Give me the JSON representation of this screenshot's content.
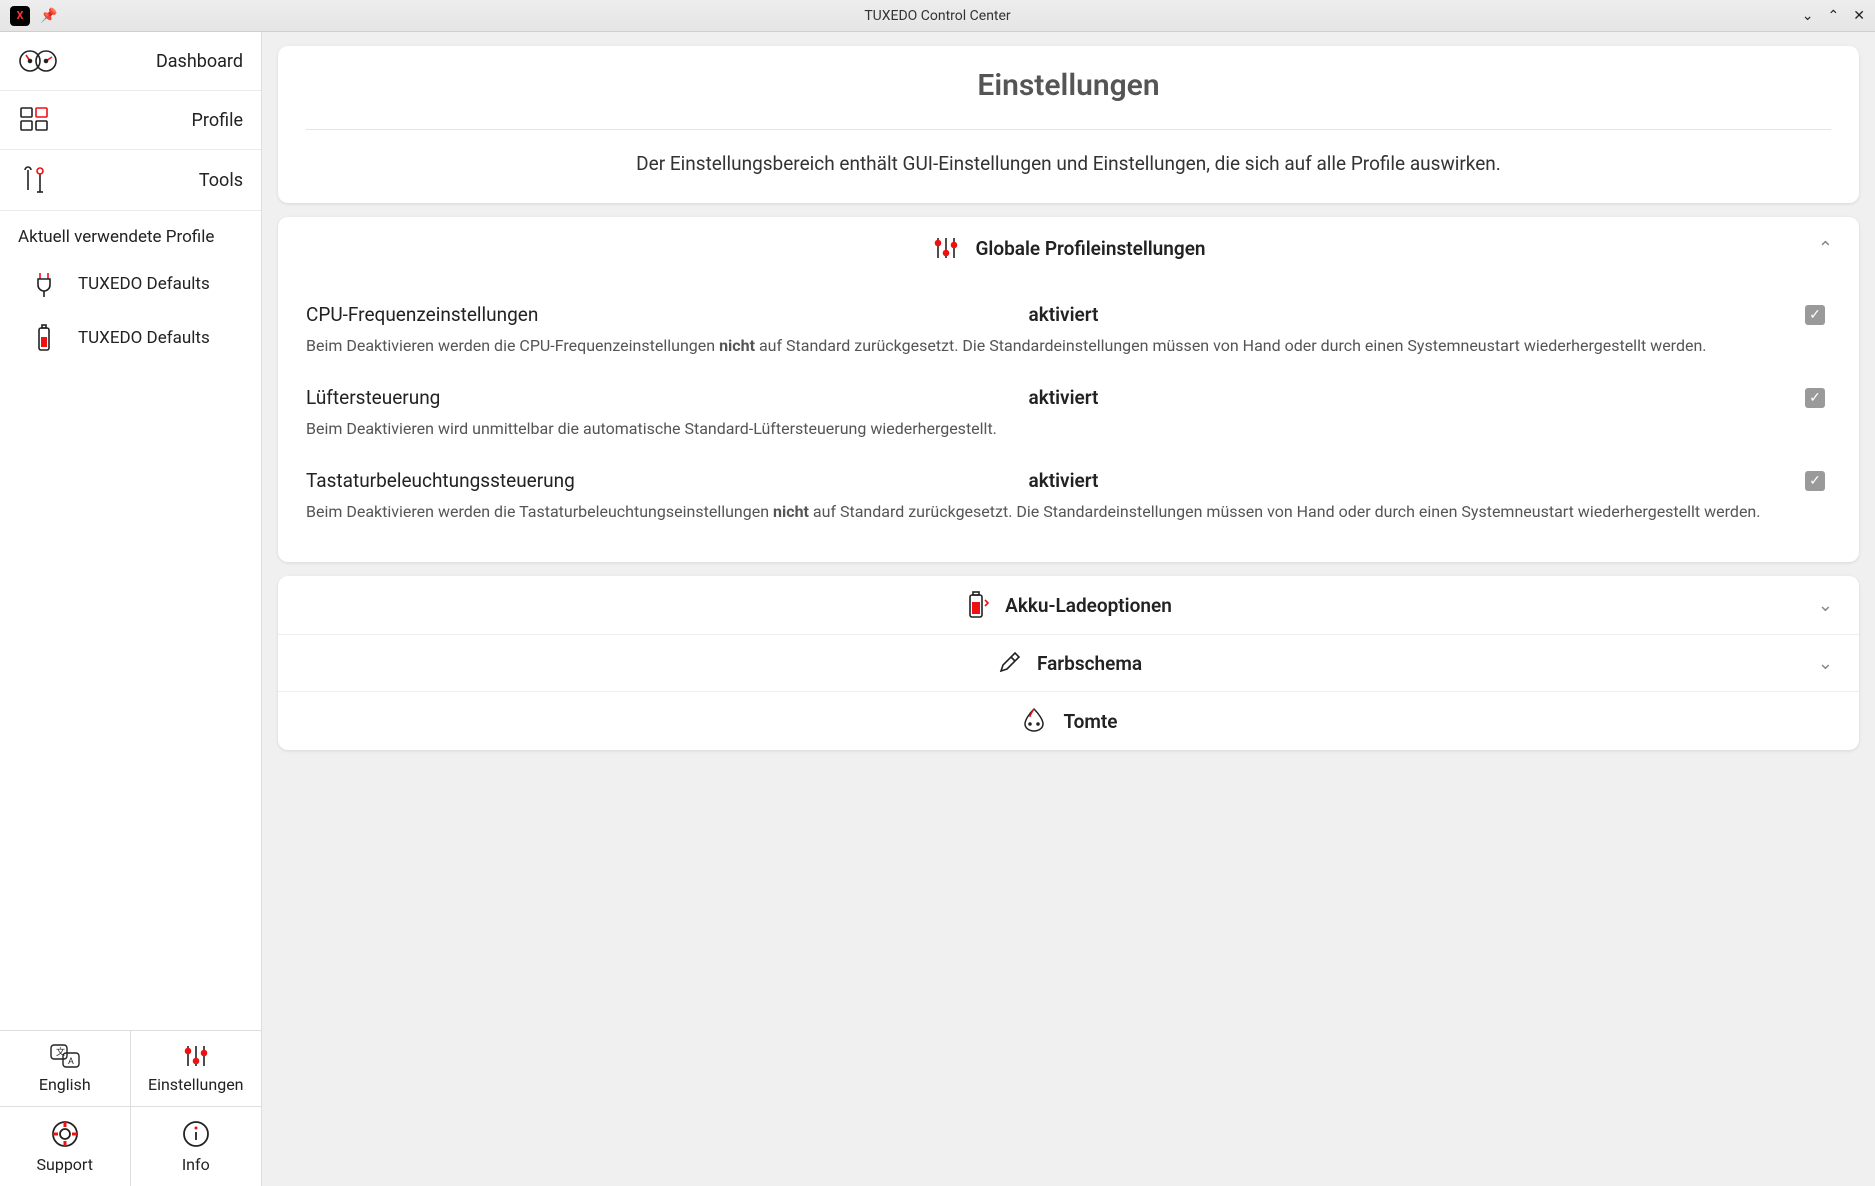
{
  "titlebar": {
    "title": "TUXEDO Control Center"
  },
  "sidebar": {
    "nav": [
      {
        "label": "Dashboard"
      },
      {
        "label": "Profile"
      },
      {
        "label": "Tools"
      }
    ],
    "section_label": "Aktuell verwendete Profile",
    "profiles": [
      {
        "label": "TUXEDO Defaults"
      },
      {
        "label": "TUXEDO Defaults"
      }
    ],
    "bottom": {
      "language": "English",
      "settings": "Einstellungen",
      "support": "Support",
      "info": "Info"
    }
  },
  "header_card": {
    "title": "Einstellungen",
    "description": "Der Einstellungsbereich enthält GUI-Einstellungen und Einstellungen, die sich auf alle Profile auswirken."
  },
  "global_section": {
    "title": "Globale Profileinstellungen",
    "settings": [
      {
        "label": "CPU-Frequenzeinstellungen",
        "value": "aktiviert",
        "checked": true,
        "desc_pre": "Beim Deaktivieren werden die CPU-Frequenzeinstellungen ",
        "desc_bold": "nicht",
        "desc_post": " auf Standard zurückgesetzt. Die Standardeinstellungen müssen von Hand oder durch einen Systemneustart wiederhergestellt werden."
      },
      {
        "label": "Lüftersteuerung",
        "value": "aktiviert",
        "checked": true,
        "desc_pre": "Beim Deaktivieren wird unmittelbar die automatische Standard-Lüftersteuerung wiederhergestellt.",
        "desc_bold": "",
        "desc_post": ""
      },
      {
        "label": "Tastaturbeleuchtungssteuerung",
        "value": "aktiviert",
        "checked": true,
        "desc_pre": "Beim Deaktivieren werden die Tastaturbeleuchtungseinstellungen ",
        "desc_bold": "nicht",
        "desc_post": " auf Standard zurückgesetzt. Die Standardeinstellungen müssen von Hand oder durch einen Systemneustart wiederhergestellt werden."
      }
    ]
  },
  "more_sections": [
    {
      "label": "Akku-Ladeoptionen",
      "has_chevron": true
    },
    {
      "label": "Farbschema",
      "has_chevron": true
    },
    {
      "label": "Tomte",
      "has_chevron": false
    }
  ]
}
